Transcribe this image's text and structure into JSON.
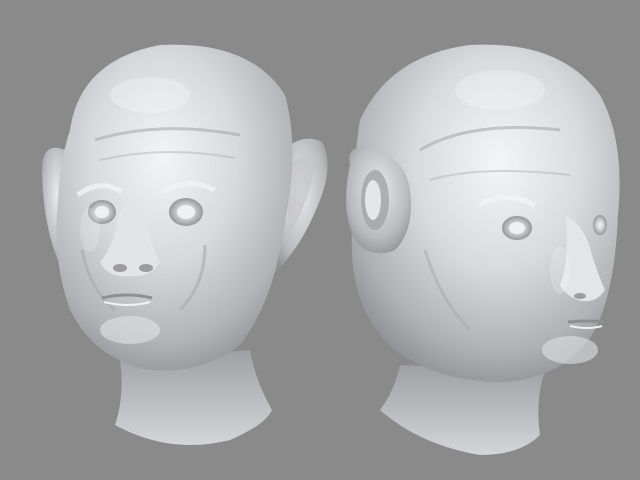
{
  "scene": {
    "background_color": "#8a8a8a",
    "model_base_color": "#d9dadc",
    "model_highlight_color": "#f5f6f8",
    "model_shadow_color": "#8d8e92",
    "views": [
      {
        "id": "front",
        "label": ""
      },
      {
        "id": "three-quarter",
        "label": ""
      }
    ]
  }
}
